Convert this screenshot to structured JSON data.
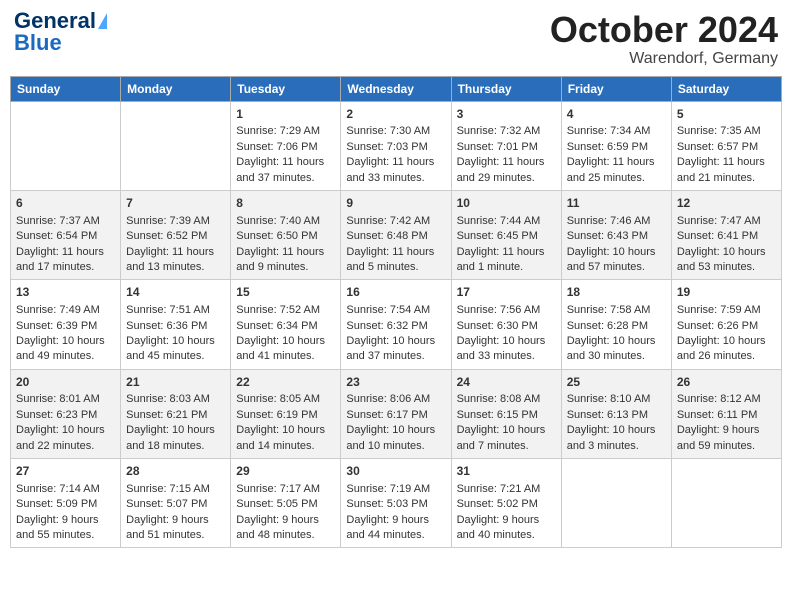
{
  "header": {
    "logo_general": "General",
    "logo_blue": "Blue",
    "month": "October 2024",
    "location": "Warendorf, Germany"
  },
  "days_of_week": [
    "Sunday",
    "Monday",
    "Tuesday",
    "Wednesday",
    "Thursday",
    "Friday",
    "Saturday"
  ],
  "weeks": [
    [
      {
        "day": "",
        "sunrise": "",
        "sunset": "",
        "daylight": ""
      },
      {
        "day": "",
        "sunrise": "",
        "sunset": "",
        "daylight": ""
      },
      {
        "day": "1",
        "sunrise": "Sunrise: 7:29 AM",
        "sunset": "Sunset: 7:06 PM",
        "daylight": "Daylight: 11 hours and 37 minutes."
      },
      {
        "day": "2",
        "sunrise": "Sunrise: 7:30 AM",
        "sunset": "Sunset: 7:03 PM",
        "daylight": "Daylight: 11 hours and 33 minutes."
      },
      {
        "day": "3",
        "sunrise": "Sunrise: 7:32 AM",
        "sunset": "Sunset: 7:01 PM",
        "daylight": "Daylight: 11 hours and 29 minutes."
      },
      {
        "day": "4",
        "sunrise": "Sunrise: 7:34 AM",
        "sunset": "Sunset: 6:59 PM",
        "daylight": "Daylight: 11 hours and 25 minutes."
      },
      {
        "day": "5",
        "sunrise": "Sunrise: 7:35 AM",
        "sunset": "Sunset: 6:57 PM",
        "daylight": "Daylight: 11 hours and 21 minutes."
      }
    ],
    [
      {
        "day": "6",
        "sunrise": "Sunrise: 7:37 AM",
        "sunset": "Sunset: 6:54 PM",
        "daylight": "Daylight: 11 hours and 17 minutes."
      },
      {
        "day": "7",
        "sunrise": "Sunrise: 7:39 AM",
        "sunset": "Sunset: 6:52 PM",
        "daylight": "Daylight: 11 hours and 13 minutes."
      },
      {
        "day": "8",
        "sunrise": "Sunrise: 7:40 AM",
        "sunset": "Sunset: 6:50 PM",
        "daylight": "Daylight: 11 hours and 9 minutes."
      },
      {
        "day": "9",
        "sunrise": "Sunrise: 7:42 AM",
        "sunset": "Sunset: 6:48 PM",
        "daylight": "Daylight: 11 hours and 5 minutes."
      },
      {
        "day": "10",
        "sunrise": "Sunrise: 7:44 AM",
        "sunset": "Sunset: 6:45 PM",
        "daylight": "Daylight: 11 hours and 1 minute."
      },
      {
        "day": "11",
        "sunrise": "Sunrise: 7:46 AM",
        "sunset": "Sunset: 6:43 PM",
        "daylight": "Daylight: 10 hours and 57 minutes."
      },
      {
        "day": "12",
        "sunrise": "Sunrise: 7:47 AM",
        "sunset": "Sunset: 6:41 PM",
        "daylight": "Daylight: 10 hours and 53 minutes."
      }
    ],
    [
      {
        "day": "13",
        "sunrise": "Sunrise: 7:49 AM",
        "sunset": "Sunset: 6:39 PM",
        "daylight": "Daylight: 10 hours and 49 minutes."
      },
      {
        "day": "14",
        "sunrise": "Sunrise: 7:51 AM",
        "sunset": "Sunset: 6:36 PM",
        "daylight": "Daylight: 10 hours and 45 minutes."
      },
      {
        "day": "15",
        "sunrise": "Sunrise: 7:52 AM",
        "sunset": "Sunset: 6:34 PM",
        "daylight": "Daylight: 10 hours and 41 minutes."
      },
      {
        "day": "16",
        "sunrise": "Sunrise: 7:54 AM",
        "sunset": "Sunset: 6:32 PM",
        "daylight": "Daylight: 10 hours and 37 minutes."
      },
      {
        "day": "17",
        "sunrise": "Sunrise: 7:56 AM",
        "sunset": "Sunset: 6:30 PM",
        "daylight": "Daylight: 10 hours and 33 minutes."
      },
      {
        "day": "18",
        "sunrise": "Sunrise: 7:58 AM",
        "sunset": "Sunset: 6:28 PM",
        "daylight": "Daylight: 10 hours and 30 minutes."
      },
      {
        "day": "19",
        "sunrise": "Sunrise: 7:59 AM",
        "sunset": "Sunset: 6:26 PM",
        "daylight": "Daylight: 10 hours and 26 minutes."
      }
    ],
    [
      {
        "day": "20",
        "sunrise": "Sunrise: 8:01 AM",
        "sunset": "Sunset: 6:23 PM",
        "daylight": "Daylight: 10 hours and 22 minutes."
      },
      {
        "day": "21",
        "sunrise": "Sunrise: 8:03 AM",
        "sunset": "Sunset: 6:21 PM",
        "daylight": "Daylight: 10 hours and 18 minutes."
      },
      {
        "day": "22",
        "sunrise": "Sunrise: 8:05 AM",
        "sunset": "Sunset: 6:19 PM",
        "daylight": "Daylight: 10 hours and 14 minutes."
      },
      {
        "day": "23",
        "sunrise": "Sunrise: 8:06 AM",
        "sunset": "Sunset: 6:17 PM",
        "daylight": "Daylight: 10 hours and 10 minutes."
      },
      {
        "day": "24",
        "sunrise": "Sunrise: 8:08 AM",
        "sunset": "Sunset: 6:15 PM",
        "daylight": "Daylight: 10 hours and 7 minutes."
      },
      {
        "day": "25",
        "sunrise": "Sunrise: 8:10 AM",
        "sunset": "Sunset: 6:13 PM",
        "daylight": "Daylight: 10 hours and 3 minutes."
      },
      {
        "day": "26",
        "sunrise": "Sunrise: 8:12 AM",
        "sunset": "Sunset: 6:11 PM",
        "daylight": "Daylight: 9 hours and 59 minutes."
      }
    ],
    [
      {
        "day": "27",
        "sunrise": "Sunrise: 7:14 AM",
        "sunset": "Sunset: 5:09 PM",
        "daylight": "Daylight: 9 hours and 55 minutes."
      },
      {
        "day": "28",
        "sunrise": "Sunrise: 7:15 AM",
        "sunset": "Sunset: 5:07 PM",
        "daylight": "Daylight: 9 hours and 51 minutes."
      },
      {
        "day": "29",
        "sunrise": "Sunrise: 7:17 AM",
        "sunset": "Sunset: 5:05 PM",
        "daylight": "Daylight: 9 hours and 48 minutes."
      },
      {
        "day": "30",
        "sunrise": "Sunrise: 7:19 AM",
        "sunset": "Sunset: 5:03 PM",
        "daylight": "Daylight: 9 hours and 44 minutes."
      },
      {
        "day": "31",
        "sunrise": "Sunrise: 7:21 AM",
        "sunset": "Sunset: 5:02 PM",
        "daylight": "Daylight: 9 hours and 40 minutes."
      },
      {
        "day": "",
        "sunrise": "",
        "sunset": "",
        "daylight": ""
      },
      {
        "day": "",
        "sunrise": "",
        "sunset": "",
        "daylight": ""
      }
    ]
  ]
}
